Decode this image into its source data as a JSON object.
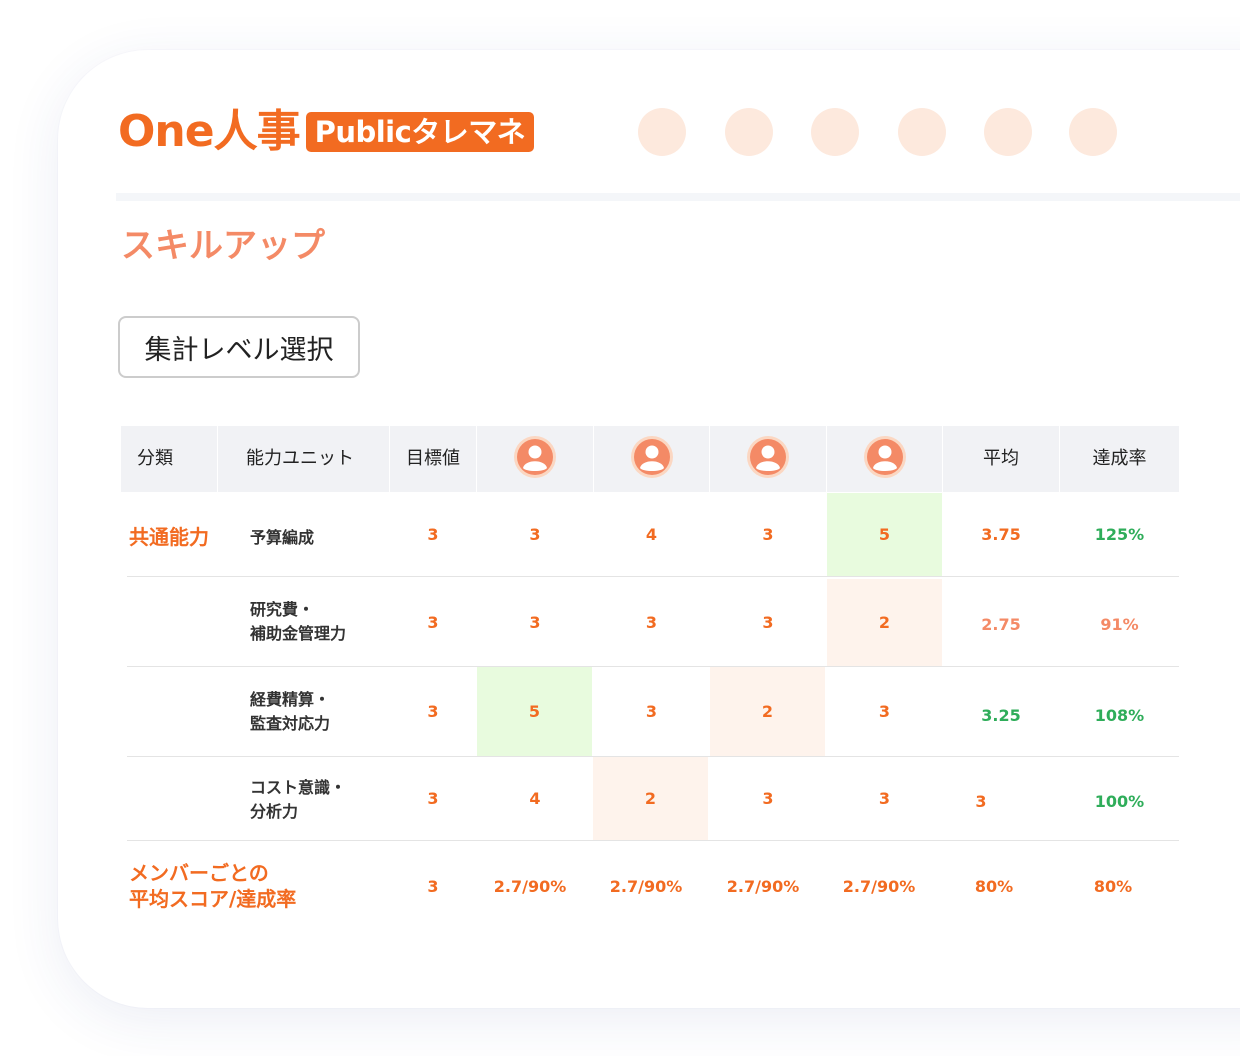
{
  "header": {
    "logo_main": "One人事",
    "logo_badge": "Publicタレマネ"
  },
  "colors": {
    "brand": "#f26b21",
    "title": "#f48a66",
    "good": "#2fad5a",
    "dot": "#fde9dd"
  },
  "page_title": "スキルアップ",
  "level_select_button": "集計レベル選択",
  "table": {
    "headers": {
      "category": "分類",
      "unit": "能力ユニット",
      "target": "目標値",
      "members": [
        "user-icon",
        "user-icon",
        "user-icon",
        "user-icon"
      ],
      "average": "平均",
      "rate": "達成率"
    },
    "category": "共通能力",
    "rows": [
      {
        "unit_line1": "予算編成",
        "unit_line2": "",
        "target": "3",
        "scores": [
          "3",
          "4",
          "3",
          "5"
        ],
        "average": "3.75",
        "rate": "125%"
      },
      {
        "unit_line1": "研究費・",
        "unit_line2": "補助金管理力",
        "target": "3",
        "scores": [
          "3",
          "3",
          "3",
          "2"
        ],
        "average": "2.75",
        "rate": "91%"
      },
      {
        "unit_line1": "経費精算・",
        "unit_line2": "監査対応力",
        "target": "3",
        "scores": [
          "5",
          "3",
          "2",
          "3"
        ],
        "average": "3.25",
        "rate": "108%"
      },
      {
        "unit_line1": "コスト意識・",
        "unit_line2": "分析力",
        "target": "3",
        "scores": [
          "4",
          "2",
          "3",
          "3"
        ],
        "average": "3",
        "rate": "100%"
      }
    ],
    "footer": {
      "label_line1": "メンバーごとの",
      "label_line2": "平均スコア/達成率",
      "target": "3",
      "scores": [
        "2.7/90%",
        "2.7/90%",
        "2.7/90%",
        "2.7/90%"
      ],
      "average": "80%",
      "rate": "80%"
    }
  }
}
